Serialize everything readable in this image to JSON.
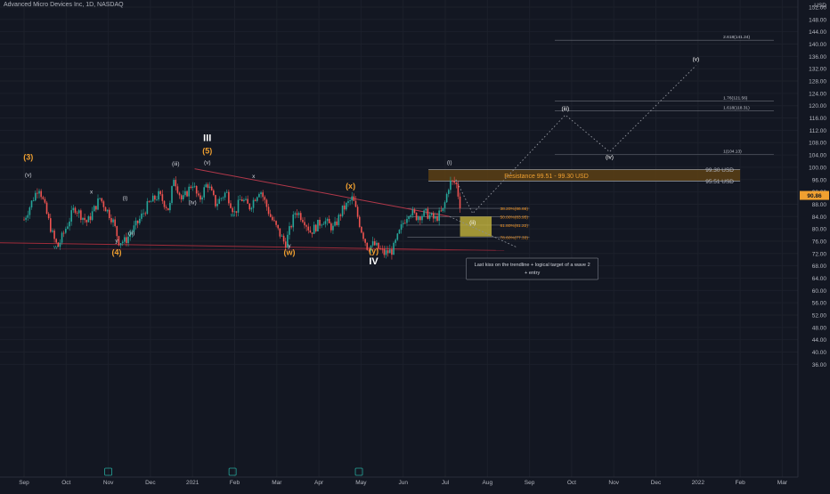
{
  "header": {
    "symbol_title": "Advanced Micro Devices Inc, 1D, NASDAQ"
  },
  "colors": {
    "background": "#131722",
    "grid": "#1c202b",
    "up": "#26a69a",
    "down": "#ef5350",
    "trendline": "#b2384a",
    "bottom_line": "#a02c3a",
    "resistance_zone": "#5c3f14",
    "resistance_text": "#f0a030",
    "target_box": "#c8b73c",
    "wave_orange": "#f0a030",
    "wave_white": "#ffffff",
    "fib_text": "#f7931a",
    "price_tag": "#f0a030"
  },
  "chart_data": {
    "type": "candlestick",
    "yaxis": {
      "unit": "USD",
      "ylim": [
        34,
        154
      ],
      "ticks": [
        "152.00",
        "148.00",
        "144.00",
        "140.00",
        "136.00",
        "132.00",
        "128.00",
        "124.00",
        "120.00",
        "116.00",
        "112.00",
        "108.00",
        "104.00",
        "100.00",
        "96.00",
        "92.00",
        "88.00",
        "84.00",
        "80.00",
        "76.00",
        "72.00",
        "68.00",
        "64.00",
        "60.00",
        "56.00",
        "52.00",
        "48.00",
        "44.00",
        "40.00",
        "36.00"
      ],
      "tick_values": [
        152,
        148,
        144,
        140,
        136,
        132,
        128,
        124,
        120,
        116,
        112,
        108,
        104,
        100,
        96,
        92,
        88,
        84,
        80,
        76,
        72,
        68,
        64,
        60,
        56,
        52,
        48,
        44,
        40,
        36
      ]
    },
    "xaxis": {
      "ticks": [
        "Sep",
        "Oct",
        "Nov",
        "Dec",
        "2021",
        "Feb",
        "Mar",
        "Apr",
        "May",
        "Jun",
        "Jul",
        "Aug",
        "Sep",
        "Oct",
        "Nov",
        "Dec",
        "2022",
        "Feb",
        "Mar"
      ],
      "tick_months": [
        0,
        1,
        2,
        3,
        4,
        5,
        6,
        7,
        8,
        9,
        10,
        11,
        12,
        13,
        14,
        15,
        16,
        17,
        18
      ]
    },
    "price_path": {
      "months": [
        0,
        0.35,
        0.7,
        0.8,
        1.2,
        1.5,
        1.8,
        2.1,
        2.25,
        2.4,
        2.7,
        2.95,
        3.2,
        3.45,
        3.55,
        3.75,
        4.0,
        4.15,
        4.35,
        4.55,
        4.8,
        5.0,
        5.15,
        5.35,
        5.6,
        5.85,
        6.2,
        6.45,
        6.65,
        6.8,
        7.1,
        7.35,
        7.55,
        7.8,
        8.0,
        8.15,
        8.3,
        8.55,
        8.75,
        9.0,
        9.15,
        9.3,
        9.55,
        9.75,
        9.95,
        10.1,
        10.25,
        10.35
      ],
      "closes": [
        83,
        94,
        77,
        74,
        87,
        82,
        90,
        83,
        76,
        76,
        82,
        88,
        91,
        86,
        97,
        89,
        95,
        89,
        95,
        88,
        92,
        85,
        90,
        87,
        93,
        84,
        75,
        86,
        83,
        79,
        83,
        80,
        86,
        90,
        80,
        74,
        75,
        72,
        73,
        82,
        86,
        84,
        85,
        83,
        86,
        95,
        95,
        88
      ]
    },
    "current_price": "90.86",
    "price_labels": [
      "99.30 USD",
      "95.51 USD"
    ],
    "price_label_values": [
      99.3,
      95.51
    ],
    "resistance_zone": {
      "label": "Resistance 99.51 - 99.30 USD",
      "from": 95.51,
      "to": 99.3
    },
    "fib_retracement": [
      {
        "label": "38.20%(86.66)",
        "value": 86.66
      },
      {
        "label": "50.00%(83.95)",
        "value": 83.95
      },
      {
        "label": "61.80%(81.22)",
        "value": 81.22
      },
      {
        "label": "78.60%(77.33)",
        "value": 77.33
      }
    ],
    "fib_extension": [
      {
        "label": "2.618(141.24)",
        "value": 141.24
      },
      {
        "label": "1.76(121.56)",
        "value": 121.56
      },
      {
        "label": "1.618(118.31)",
        "value": 118.31
      },
      {
        "label": "1(104.13)",
        "value": 104.13
      }
    ],
    "projection": {
      "months": [
        10.25,
        10.65,
        12.85,
        13.9,
        15.95
      ],
      "values": [
        96,
        85,
        117,
        105,
        133
      ],
      "labels": [
        "(ii)",
        "(iii)",
        "(iv)",
        "(v)"
      ]
    },
    "target_box": {
      "value_high": 84,
      "value_low": 77.5
    },
    "wave_labels": [
      {
        "text": "(3)",
        "m": 0.1,
        "v": 102.5,
        "style": "orange"
      },
      {
        "text": "(v)",
        "m": 0.1,
        "v": 97,
        "style": "small"
      },
      {
        "text": "w",
        "m": 0.75,
        "v": 73.5,
        "style": "green"
      },
      {
        "text": "x",
        "m": 1.6,
        "v": 91.5,
        "style": "small"
      },
      {
        "text": "y",
        "m": 2.2,
        "v": 75.5,
        "style": "small"
      },
      {
        "text": "(4)",
        "m": 2.2,
        "v": 71.5,
        "style": "orange"
      },
      {
        "text": "(i)",
        "m": 2.4,
        "v": 89.5,
        "style": "small"
      },
      {
        "text": "(ii)",
        "m": 2.55,
        "v": 78,
        "style": "small"
      },
      {
        "text": "(iii)",
        "m": 3.6,
        "v": 100.5,
        "style": "small"
      },
      {
        "text": "(iv)",
        "m": 4.0,
        "v": 88,
        "style": "small"
      },
      {
        "text": "(v)",
        "m": 4.35,
        "v": 101,
        "style": "small"
      },
      {
        "text": "III",
        "m": 4.35,
        "v": 108.5,
        "style": "white"
      },
      {
        "text": "(5)",
        "m": 4.35,
        "v": 104.5,
        "style": "orange"
      },
      {
        "text": "w",
        "m": 4.95,
        "v": 84,
        "style": "green"
      },
      {
        "text": "x",
        "m": 5.45,
        "v": 96.5,
        "style": "small"
      },
      {
        "text": "y",
        "m": 6.3,
        "v": 74,
        "style": "small"
      },
      {
        "text": "(w)",
        "m": 6.3,
        "v": 71.5,
        "style": "orange"
      },
      {
        "text": "(x)",
        "m": 7.75,
        "v": 93,
        "style": "orange"
      },
      {
        "text": "(y)",
        "m": 8.3,
        "v": 72,
        "style": "orange"
      },
      {
        "text": "IV",
        "m": 8.3,
        "v": 68.5,
        "style": "white"
      },
      {
        "text": "(i)",
        "m": 10.1,
        "v": 101,
        "style": "small"
      }
    ],
    "annotation": {
      "line1": "Last kiss on the trendline + logical target of a wave 2",
      "line2": "+ entry"
    },
    "earnings_markers": [
      2.0,
      4.95,
      7.95
    ]
  }
}
